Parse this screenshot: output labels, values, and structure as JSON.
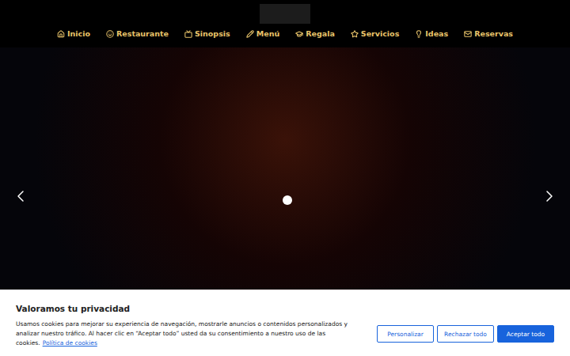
{
  "nav": {
    "items": [
      {
        "label": "Inicio"
      },
      {
        "label": "Restaurante"
      },
      {
        "label": "Sinopsis"
      },
      {
        "label": "Menú"
      },
      {
        "label": "Regala"
      },
      {
        "label": "Servicios"
      },
      {
        "label": "Ideas"
      },
      {
        "label": "Reservas"
      }
    ]
  },
  "slider": {
    "slides": [
      {
        "selected": true
      }
    ]
  },
  "cookie_banner": {
    "title": "Valoramos tu privacidad",
    "text": "Usamos cookies para mejorar su experiencia de navegación, mostrarle anuncios o contenidos personalizados y analizar nuestro tráfico. Al hacer clic en “Aceptar todo” usted da su consentimiento a nuestro uso de las cookies.",
    "link": "Política de cookies",
    "buttons": [
      {
        "label": "Personalizar",
        "kind": "outline"
      },
      {
        "label": "Rechazar todo",
        "kind": "outline"
      },
      {
        "label": "Aceptar todo",
        "kind": "filled"
      }
    ]
  }
}
